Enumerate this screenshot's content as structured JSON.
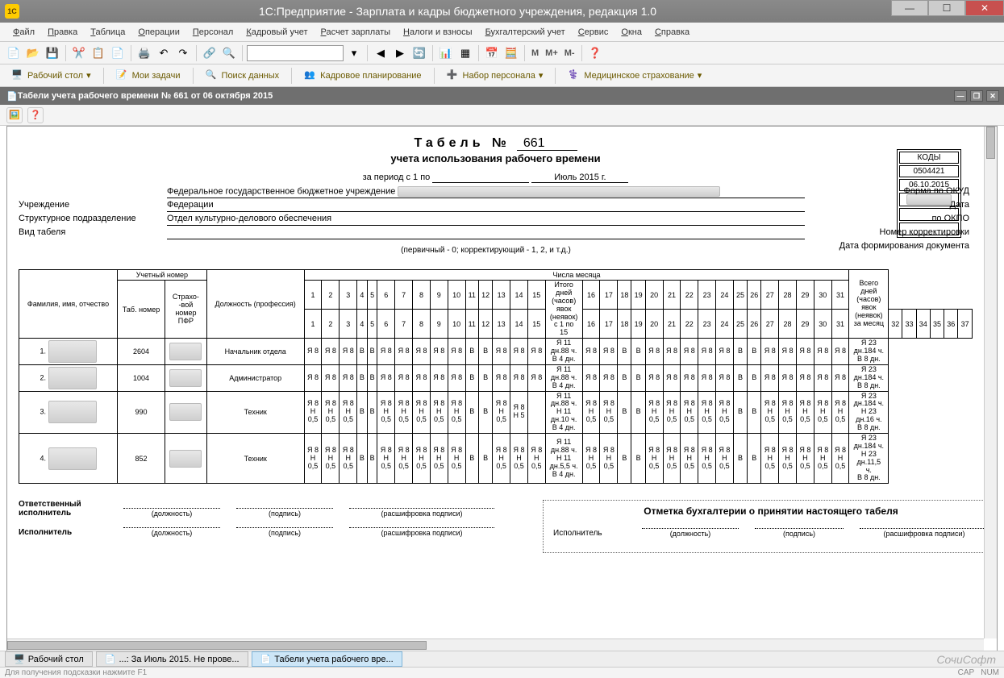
{
  "window": {
    "title": "1С:Предприятие - Зарплата и кадры бюджетного учреждения, редакция 1.0"
  },
  "menu": [
    "Файл",
    "Правка",
    "Таблица",
    "Операции",
    "Персонал",
    "Кадровый учет",
    "Расчет зарплаты",
    "Налоги и взносы",
    "Бухгалтерский учет",
    "Сервис",
    "Окна",
    "Справка"
  ],
  "toolbar_text": {
    "m": "M",
    "mplus": "M+",
    "mminus": "M-"
  },
  "nav": [
    {
      "label": "Рабочий стол"
    },
    {
      "label": "Мои задачи"
    },
    {
      "label": "Поиск данных"
    },
    {
      "label": "Кадровое планирование"
    },
    {
      "label": "Набор персонала"
    },
    {
      "label": "Медицинское страхование"
    }
  ],
  "doc_tab": "Табели учета рабочего времени № 661 от 06 октября 2015",
  "report": {
    "title_word": "Табель №",
    "title_num": "661",
    "subtitle": "учета использования рабочего времени",
    "period_label": "за период с 1 по",
    "period_val": "Июль 2015 г.",
    "org_label": "Учреждение",
    "org_prefix": "Федеральное государственное бюджетное учреждение",
    "dept_label": "Структурное подразделение",
    "dept_val": "Отдел культурно-делового обеспечения",
    "kind_label": "Вид табеля",
    "note": "(первичный - 0; корректирующий - 1, 2, и т.д.)",
    "right_labels": {
      "okud": "Форма по ОКУД",
      "date": "Дата",
      "okpo": "по ОКПО",
      "corr": "Номер корректировки",
      "formed": "Дата формирования документа"
    },
    "codes": {
      "hdr": "КОДЫ",
      "okud": "0504421",
      "date": "06.10.2015",
      "okpo": "",
      "corr": "",
      "formed": ""
    }
  },
  "columns": {
    "fio": "Фамилия, имя, отчество",
    "uch": "Учетный номер",
    "tab": "Таб. номер",
    "pfr": "Страхо-\n-вой\nномер\nПФР",
    "pos": "Должность (профессия)",
    "days_hdr": "Числа месяца",
    "mid": "Итого\nдней\n(часов)\nявок\n(неявок)\nс 1 по\n15",
    "total": "Всего\nдней\n(часов)\nявок\n(неявок)\nза месяц"
  },
  "colnums": [
    "1",
    "2",
    "3",
    "4",
    "5",
    "6",
    "7",
    "8",
    "9",
    "10",
    "11",
    "12",
    "13",
    "14",
    "15",
    "16",
    "17",
    "18",
    "19",
    "20",
    "21",
    "22",
    "23",
    "24",
    "25",
    "26",
    "27",
    "28",
    "29",
    "30",
    "31",
    "32",
    "33",
    "34",
    "35",
    "36",
    "37"
  ],
  "daynums_a": [
    "1",
    "2",
    "3",
    "4",
    "5",
    "6",
    "7",
    "8",
    "9",
    "10",
    "11",
    "12",
    "13",
    "14",
    "15"
  ],
  "daynums_b": [
    "16",
    "17",
    "18",
    "19",
    "20",
    "21",
    "22",
    "23",
    "24",
    "25",
    "26",
    "27",
    "28",
    "29",
    "30",
    "31"
  ],
  "rows": [
    {
      "n": "1",
      "tab": "2604",
      "pos": "Начальник отдела",
      "a": [
        "Я 8",
        "Я 8",
        "Я 8",
        "В",
        "В",
        "Я 8",
        "Я 8",
        "Я 8",
        "Я 8",
        "Я 8",
        "В",
        "В",
        "Я 8",
        "Я 8",
        "Я 8"
      ],
      "mid": "Я 11\nдн.88 ч.\nВ 4 дн.",
      "b": [
        "Я 8",
        "Я 8",
        "В",
        "В",
        "Я 8",
        "Я 8",
        "Я 8",
        "Я 8",
        "Я 8",
        "В",
        "В",
        "Я 8",
        "Я 8",
        "Я 8",
        "Я 8",
        "Я 8"
      ],
      "tot": "Я 23\nдн.184 ч.\nВ 8 дн."
    },
    {
      "n": "2",
      "tab": "1004",
      "pos": "Администратор",
      "a": [
        "Я 8",
        "Я 8",
        "Я 8",
        "В",
        "В",
        "Я 8",
        "Я 8",
        "Я 8",
        "Я 8",
        "Я 8",
        "В",
        "В",
        "Я 8",
        "Я 8",
        "Я 8"
      ],
      "mid": "Я 11\nдн.88 ч.\nВ 4 дн.",
      "b": [
        "Я 8",
        "Я 8",
        "В",
        "В",
        "Я 8",
        "Я 8",
        "Я 8",
        "Я 8",
        "Я 8",
        "В",
        "В",
        "Я 8",
        "Я 8",
        "Я 8",
        "Я 8",
        "Я 8"
      ],
      "tot": "Я 23\nдн.184 ч.\nВ 8 дн."
    },
    {
      "n": "3",
      "tab": "990",
      "pos": "Техник",
      "a": [
        "Я 8\nН\n0,5",
        "Я 8\nН\n0,5",
        "Я 8\nН\n0,5",
        "В",
        "В",
        "Я 8\nН\n0,5",
        "Я 8\nН\n0,5",
        "Я 8\nН\n0,5",
        "Я 8\nН\n0,5",
        "Я 8\nН\n0,5",
        "В",
        "В",
        "Я 8\nН\n0,5",
        "Я 8\nН 5",
        ""
      ],
      "mid": "Я 11\nдн.88 ч.\nН 11\nдн.10 ч.\nВ 4 дн.",
      "b": [
        "Я 8\nН\n0,5",
        "Я 8\nН\n0,5",
        "В",
        "В",
        "Я 8\nН\n0,5",
        "Я 8\nН\n0,5",
        "Я 8\nН\n0,5",
        "Я 8\nН\n0,5",
        "Я 8\nН\n0,5",
        "В",
        "В",
        "Я 8\nН\n0,5",
        "Я 8\nН\n0,5",
        "Я 8\nН\n0,5",
        "Я 8\nН\n0,5",
        "Я 8\nН\n0,5"
      ],
      "tot": "Я 23\nдн.184 ч.\nН 23\nдн.16 ч.\nВ 8 дн."
    },
    {
      "n": "4",
      "tab": "852",
      "pos": "Техник",
      "a": [
        "Я 8\nН\n0,5",
        "Я 8\nН\n0,5",
        "Я 8\nН\n0,5",
        "В",
        "В",
        "Я 8\nН\n0,5",
        "Я 8\nН\n0,5",
        "Я 8\nН\n0,5",
        "Я 8\nН\n0,5",
        "Я 8\nН\n0,5",
        "В",
        "В",
        "Я 8\nН\n0,5",
        "Я 8\nН\n0,5",
        "Я 8\nН\n0,5"
      ],
      "mid": "Я 11\nдн.88 ч.\nН 11\nдн.5,5 ч.\nВ 4 дн.",
      "b": [
        "Я 8\nН\n0,5",
        "Я 8\nН\n0,5",
        "В",
        "В",
        "Я 8\nН\n0,5",
        "Я 8\nН\n0,5",
        "Я 8\nН\n0,5",
        "Я 8\nН\n0,5",
        "Я 8\nН\n0,5",
        "В",
        "В",
        "Я 8\nН\n0,5",
        "Я 8\nН\n0,5",
        "Я 8\nН\n0,5",
        "Я 8\nН\n0,5",
        "Я 8\nН\n0,5"
      ],
      "tot": "Я 23\nдн.184 ч.\nН 23\nдн.11,5\nч.\nВ 8 дн."
    }
  ],
  "sig": {
    "resp": "Ответственный исполнитель",
    "exec": "Исполнитель",
    "pos": "(должность)",
    "sign": "(подпись)",
    "dec": "(расшифровка подписи)",
    "acct_title": "Отметка бухгалтерии о принятии настоящего табеля",
    "acct_exec": "Исполнитель"
  },
  "taskbar": [
    {
      "label": "Рабочий стол",
      "active": false
    },
    {
      "label": "...: За Июль 2015. Не прове...",
      "active": false
    },
    {
      "label": "Табели учета рабочего вре...",
      "active": true
    }
  ],
  "brand": "СочиСофт",
  "status": {
    "hint": "Для получения подсказки нажмите F1",
    "cap": "CAP",
    "num": "NUM"
  }
}
